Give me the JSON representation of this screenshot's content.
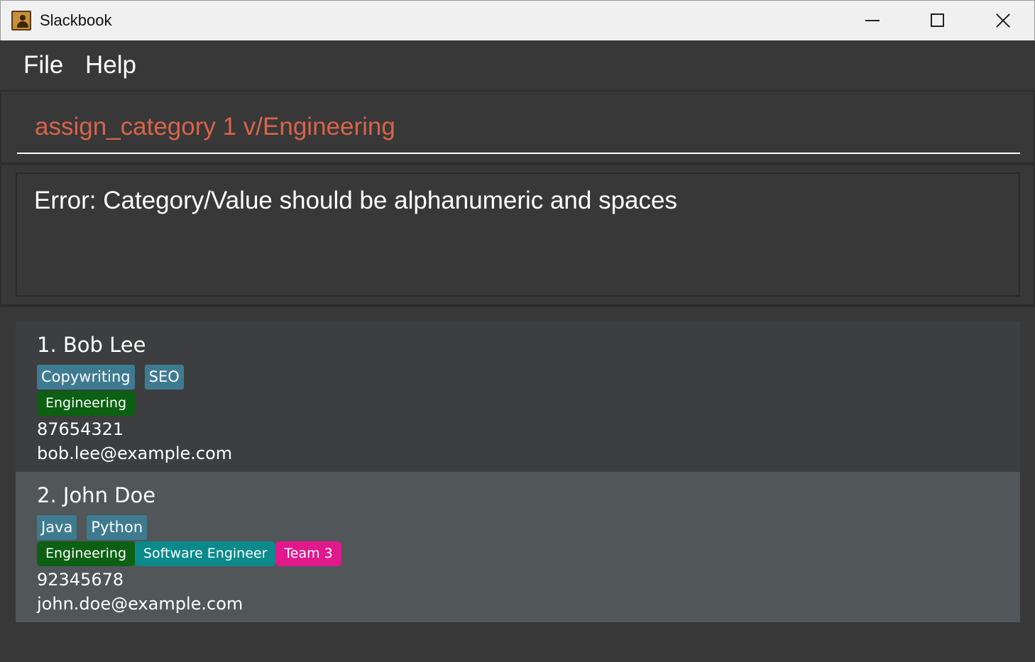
{
  "window": {
    "title": "Slackbook",
    "icon": "address-book-icon"
  },
  "menu": {
    "items": [
      "File",
      "Help"
    ]
  },
  "command_box": {
    "value": "assign_category 1 v/Engineering",
    "color": "#d8644a"
  },
  "result_box": {
    "message": "Error: Category/Value should be alphanumeric and spaces"
  },
  "persons": [
    {
      "name": "1. Bob Lee",
      "tags": [
        "Copywriting",
        "SEO"
      ],
      "categories": [
        {
          "label": "Engineering",
          "color": "#0b6012"
        }
      ],
      "phone": "87654321",
      "email": "bob.lee@example.com"
    },
    {
      "name": "2. John Doe",
      "tags": [
        "Java",
        "Python"
      ],
      "categories": [
        {
          "label": "Engineering",
          "color": "#0b6012"
        },
        {
          "label": "Software Engineer",
          "color": "#0a8a8a"
        },
        {
          "label": "Team 3",
          "color": "#e0198d"
        }
      ],
      "phone": "92345678",
      "email": "john.doe@example.com"
    }
  ],
  "colors": {
    "background": "#383838",
    "tag": "#3e7b91",
    "selected_card": "#515658"
  }
}
